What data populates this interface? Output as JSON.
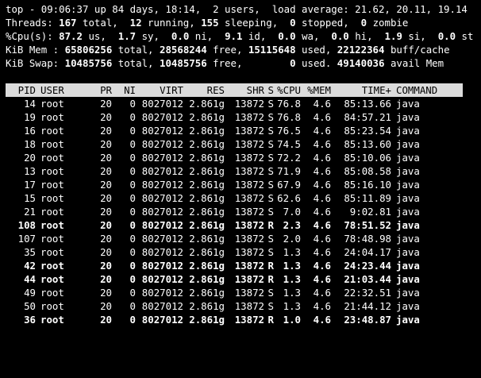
{
  "summary": {
    "uptime_line": "top - 09:06:37 up 84 days, 18:14,  2 users,  load average: 21.62, 20.11, 19.14",
    "threads": {
      "label": "Threads: ",
      "total": "167",
      "total_label": " total,  ",
      "running": "12",
      "running_label": " running, ",
      "sleeping": "155",
      "sleeping_label": " sleeping,  ",
      "stopped": "0",
      "stopped_label": " stopped,  ",
      "zombie": "0",
      "zombie_label": " zombie"
    },
    "cpu": {
      "label": "%Cpu(s): ",
      "us": "87.2",
      "us_label": " us,  ",
      "sy": "1.7",
      "sy_label": " sy,  ",
      "ni": "0.0",
      "ni_label": " ni,  ",
      "id": "9.1",
      "id_label": " id,  ",
      "wa": "0.0",
      "wa_label": " wa,  ",
      "hi": "0.0",
      "hi_label": " hi,  ",
      "si": "1.9",
      "si_label": " si,  ",
      "st": "0.0",
      "st_label": " st"
    },
    "mem": {
      "label": "KiB Mem : ",
      "total": "65806256",
      "total_label": " total, ",
      "free": "28568244",
      "free_label": " free, ",
      "used": "15115648",
      "used_label": " used, ",
      "buff": "22122364",
      "buff_label": " buff/cache"
    },
    "swap": {
      "label": "KiB Swap: ",
      "total": "10485756",
      "total_label": " total, ",
      "free": "10485756",
      "free_label": " free,        ",
      "used": "0",
      "used_label": " used. ",
      "avail": "49140036",
      "avail_label": " avail Mem"
    }
  },
  "table": {
    "columns": [
      "PID",
      "USER",
      "PR",
      "NI",
      "VIRT",
      "RES",
      "SHR",
      "S",
      "%CPU",
      "%MEM",
      "TIME+",
      "COMMAND"
    ],
    "rows": [
      [
        "14",
        "root",
        "20",
        "0",
        "8027012",
        "2.861g",
        "13872",
        "S",
        "76.8",
        "4.6",
        "85:13.66",
        "java"
      ],
      [
        "19",
        "root",
        "20",
        "0",
        "8027012",
        "2.861g",
        "13872",
        "S",
        "76.8",
        "4.6",
        "84:57.21",
        "java"
      ],
      [
        "16",
        "root",
        "20",
        "0",
        "8027012",
        "2.861g",
        "13872",
        "S",
        "76.5",
        "4.6",
        "85:23.54",
        "java"
      ],
      [
        "18",
        "root",
        "20",
        "0",
        "8027012",
        "2.861g",
        "13872",
        "S",
        "74.5",
        "4.6",
        "85:13.60",
        "java"
      ],
      [
        "20",
        "root",
        "20",
        "0",
        "8027012",
        "2.861g",
        "13872",
        "S",
        "72.2",
        "4.6",
        "85:10.06",
        "java"
      ],
      [
        "13",
        "root",
        "20",
        "0",
        "8027012",
        "2.861g",
        "13872",
        "S",
        "71.9",
        "4.6",
        "85:08.58",
        "java"
      ],
      [
        "17",
        "root",
        "20",
        "0",
        "8027012",
        "2.861g",
        "13872",
        "S",
        "67.9",
        "4.6",
        "85:16.10",
        "java"
      ],
      [
        "15",
        "root",
        "20",
        "0",
        "8027012",
        "2.861g",
        "13872",
        "S",
        "62.6",
        "4.6",
        "85:11.89",
        "java"
      ],
      [
        "21",
        "root",
        "20",
        "0",
        "8027012",
        "2.861g",
        "13872",
        "S",
        "7.0",
        "4.6",
        "9:02.81",
        "java"
      ],
      [
        "108",
        "root",
        "20",
        "0",
        "8027012",
        "2.861g",
        "13872",
        "R",
        "2.3",
        "4.6",
        "78:51.52",
        "java"
      ],
      [
        "107",
        "root",
        "20",
        "0",
        "8027012",
        "2.861g",
        "13872",
        "S",
        "2.0",
        "4.6",
        "78:48.98",
        "java"
      ],
      [
        "35",
        "root",
        "20",
        "0",
        "8027012",
        "2.861g",
        "13872",
        "S",
        "1.3",
        "4.6",
        "24:04.17",
        "java"
      ],
      [
        "42",
        "root",
        "20",
        "0",
        "8027012",
        "2.861g",
        "13872",
        "R",
        "1.3",
        "4.6",
        "24:23.44",
        "java"
      ],
      [
        "44",
        "root",
        "20",
        "0",
        "8027012",
        "2.861g",
        "13872",
        "R",
        "1.3",
        "4.6",
        "21:03.44",
        "java"
      ],
      [
        "49",
        "root",
        "20",
        "0",
        "8027012",
        "2.861g",
        "13872",
        "S",
        "1.3",
        "4.6",
        "22:32.51",
        "java"
      ],
      [
        "50",
        "root",
        "20",
        "0",
        "8027012",
        "2.861g",
        "13872",
        "S",
        "1.3",
        "4.6",
        "21:44.12",
        "java"
      ],
      [
        "36",
        "root",
        "20",
        "0",
        "8027012",
        "2.861g",
        "13872",
        "R",
        "1.0",
        "4.6",
        "23:48.87",
        "java"
      ]
    ]
  },
  "colors": {
    "background": "#000000",
    "text": "#ffffff",
    "header_bar": "#dcdcdc",
    "header_text": "#000000"
  }
}
